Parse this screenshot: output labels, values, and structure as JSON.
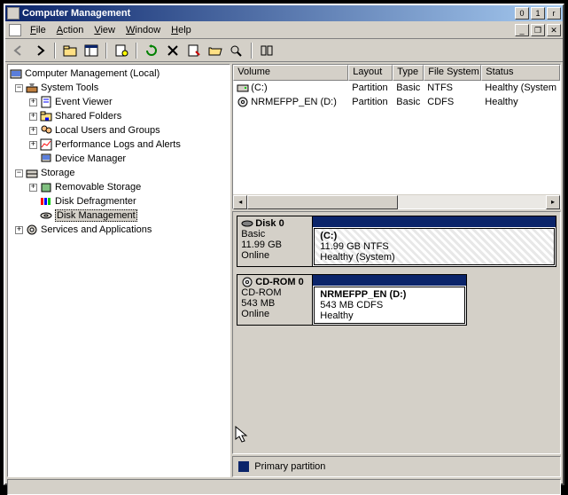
{
  "window": {
    "title": "Computer Management"
  },
  "menu": {
    "file": "File",
    "action": "Action",
    "view": "View",
    "window": "Window",
    "help": "Help"
  },
  "tree": {
    "root": "Computer Management (Local)",
    "system_tools": "System Tools",
    "event_viewer": "Event Viewer",
    "shared_folders": "Shared Folders",
    "local_users": "Local Users and Groups",
    "perf_logs": "Performance Logs and Alerts",
    "device_mgr": "Device Manager",
    "storage": "Storage",
    "removable": "Removable Storage",
    "defrag": "Disk Defragmenter",
    "diskmgmt": "Disk Management",
    "services": "Services and Applications"
  },
  "list": {
    "cols": {
      "volume": "Volume",
      "layout": "Layout",
      "type": "Type",
      "fs": "File System",
      "status": "Status"
    },
    "rows": [
      {
        "volume": "(C:)",
        "layout": "Partition",
        "type": "Basic",
        "fs": "NTFS",
        "status": "Healthy (System"
      },
      {
        "volume": "NRMEFPP_EN (D:)",
        "layout": "Partition",
        "type": "Basic",
        "fs": "CDFS",
        "status": "Healthy"
      }
    ]
  },
  "disks": {
    "disk0": {
      "title": "Disk 0",
      "type": "Basic",
      "size": "11.99 GB",
      "state": "Online",
      "part_name": "(C:)",
      "part_size": "11.99 GB NTFS",
      "part_status": "Healthy (System)"
    },
    "cd0": {
      "title": "CD-ROM 0",
      "type": "CD-ROM",
      "size": "543 MB",
      "state": "Online",
      "part_name": "NRMEFPP_EN (D:)",
      "part_size": "543 MB CDFS",
      "part_status": "Healthy"
    }
  },
  "legend": {
    "primary": "Primary partition"
  }
}
